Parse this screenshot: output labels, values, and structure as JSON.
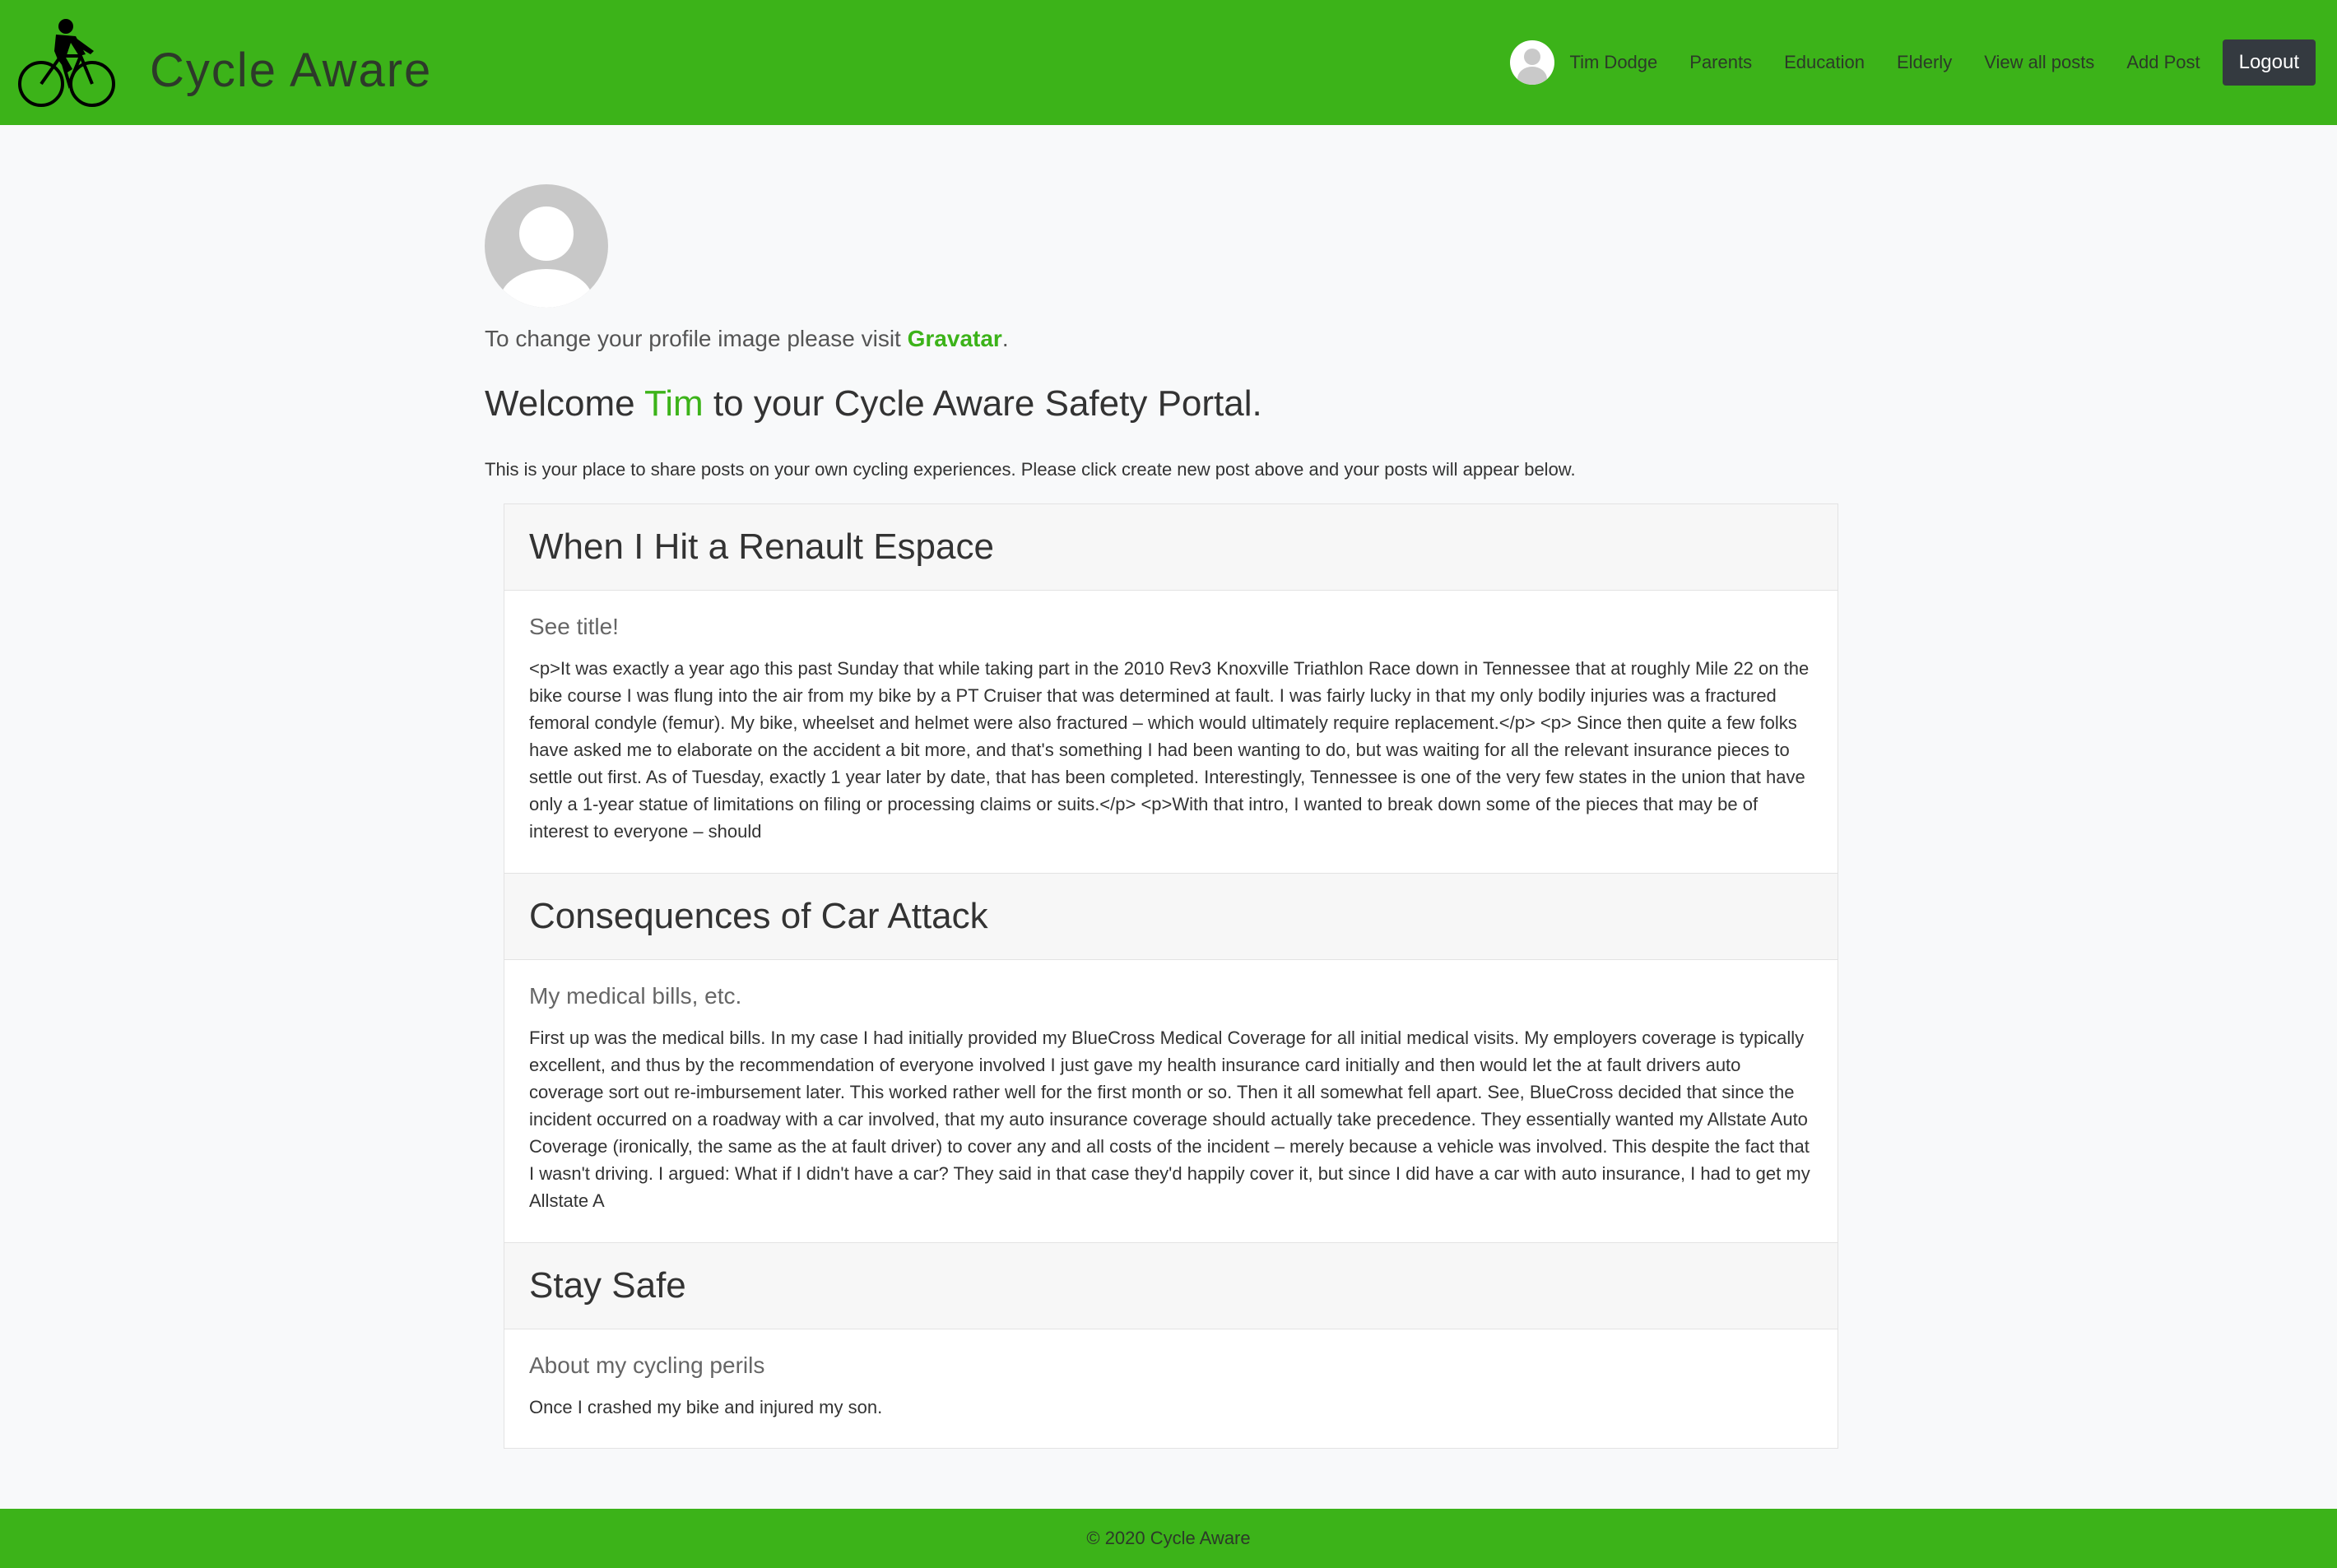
{
  "brand": {
    "name": "Cycle Aware",
    "logo_icon": "cyclist-silhouette-icon"
  },
  "nav": {
    "user_name": "Tim Dodge",
    "links": [
      "Parents",
      "Education",
      "Elderly",
      "View all posts",
      "Add Post"
    ],
    "logout_label": "Logout"
  },
  "profile": {
    "gravatar_prefix": "To change your profile image please visit ",
    "gravatar_link": "Gravatar",
    "gravatar_suffix": "."
  },
  "welcome": {
    "prefix": "Welcome ",
    "name": "Tim",
    "suffix": " to your Cycle Aware Safety Portal."
  },
  "intro": "This is your place to share posts on your own cycling experiences. Please click create new post above and your posts will appear below.",
  "posts": [
    {
      "title": "When I Hit a Renault Espace",
      "subtitle": "See title!",
      "body": "<p>It was exactly a year ago this past Sunday that while taking part in the 2010 Rev3 Knoxville Triathlon Race down in Tennessee that at roughly Mile 22 on the bike course I was flung into the air from my bike by a PT Cruiser that was determined at fault. I was fairly lucky in that my only bodily injuries was a fractured femoral condyle (femur). My bike, wheelset and helmet were also fractured – which would ultimately require replacement.</p> <p> Since then quite a few folks have asked me to elaborate on the accident a bit more, and that's something I had been wanting to do, but was waiting for all the relevant insurance pieces to settle out first. As of Tuesday, exactly 1 year later by date, that has been completed. Interestingly, Tennessee is one of the very few states in the union that have only a 1-year statue of limitations on filing or processing claims or suits.</p> <p>With that intro, I wanted to break down some of the pieces that may be of interest to everyone – should"
    },
    {
      "title": "Consequences of Car Attack",
      "subtitle": "My medical bills, etc.",
      "body": "First up was the medical bills. In my case I had initially provided my BlueCross Medical Coverage for all initial medical visits. My employers coverage is typically excellent, and thus by the recommendation of everyone involved I just gave my health insurance card initially and then would let the at fault drivers auto coverage sort out re-imbursement later. This worked rather well for the first month or so. Then it all somewhat fell apart. See, BlueCross decided that since the incident occurred on a roadway with a car involved, that my auto insurance coverage should actually take precedence. They essentially wanted my Allstate Auto Coverage (ironically, the same as the at fault driver) to cover any and all costs of the incident – merely because a vehicle was involved. This despite the fact that I wasn't driving. I argued: What if I didn't have a car? They said in that case they'd happily cover it, but since I did have a car with auto insurance, I had to get my Allstate A"
    },
    {
      "title": "Stay Safe",
      "subtitle": "About my cycling perils",
      "body": "Once I crashed my bike and injured my son."
    }
  ],
  "footer": {
    "text": "© 2020 Cycle Aware"
  },
  "colors": {
    "brand_green": "#3cb319",
    "dark": "#343a40",
    "page_bg": "#f8f9fa"
  }
}
